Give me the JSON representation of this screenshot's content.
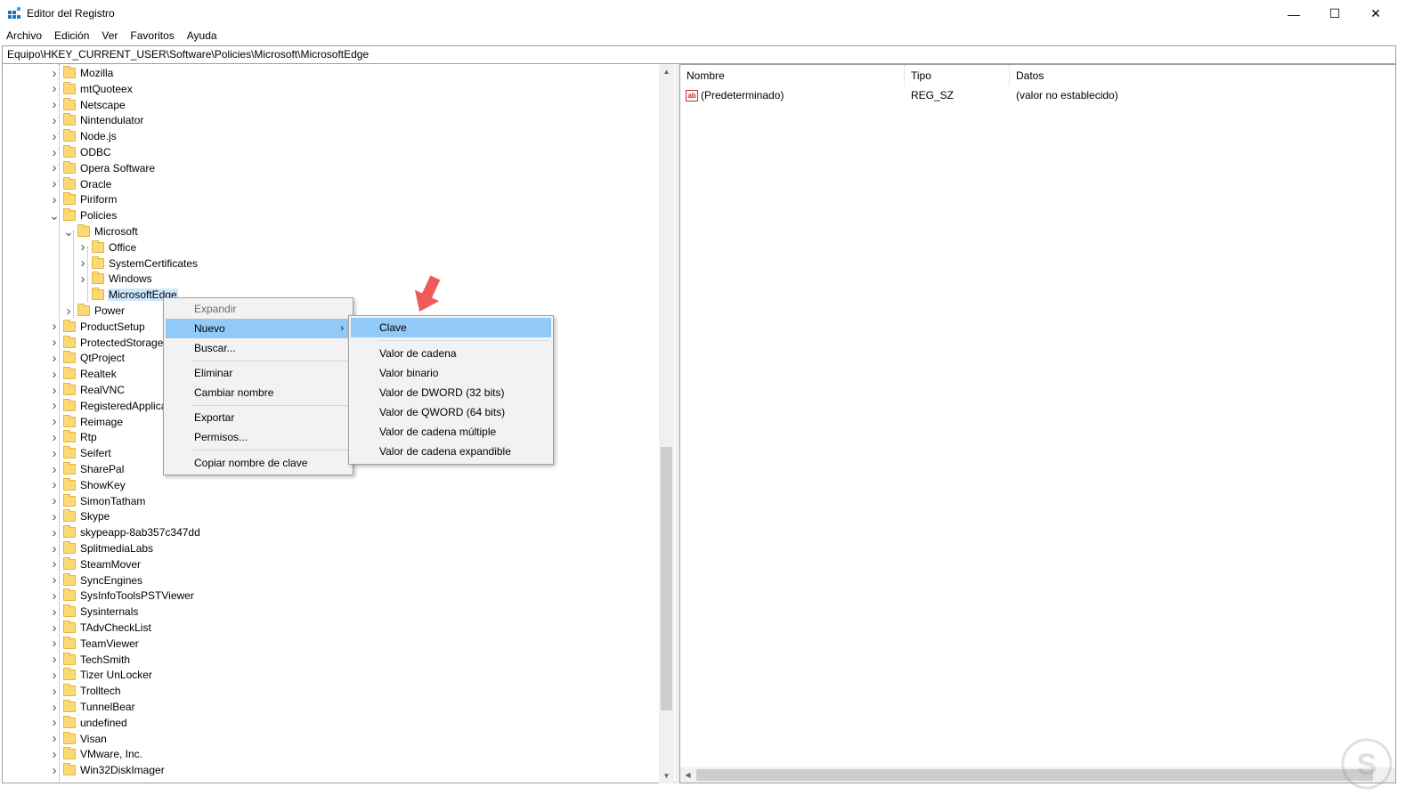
{
  "window": {
    "title": "Editor del Registro",
    "controls": {
      "minimize": "—",
      "maximize": "☐",
      "close": "✕"
    }
  },
  "menu": [
    "Archivo",
    "Edición",
    "Ver",
    "Favoritos",
    "Ayuda"
  ],
  "address": "Equipo\\HKEY_CURRENT_USER\\Software\\Policies\\Microsoft\\MicrosoftEdge",
  "tree": {
    "items": [
      {
        "label": "Mozilla",
        "level": 0,
        "expander": ">"
      },
      {
        "label": "mtQuoteex",
        "level": 0,
        "expander": ">"
      },
      {
        "label": "Netscape",
        "level": 0,
        "expander": ">"
      },
      {
        "label": "Nintendulator",
        "level": 0,
        "expander": ">"
      },
      {
        "label": "Node.js",
        "level": 0,
        "expander": ">"
      },
      {
        "label": "ODBC",
        "level": 0,
        "expander": ">"
      },
      {
        "label": "Opera Software",
        "level": 0,
        "expander": ">"
      },
      {
        "label": "Oracle",
        "level": 0,
        "expander": ">"
      },
      {
        "label": "Piriform",
        "level": 0,
        "expander": ">"
      },
      {
        "label": "Policies",
        "level": 0,
        "expander": "v"
      },
      {
        "label": "Microsoft",
        "level": 1,
        "expander": "v"
      },
      {
        "label": "Office",
        "level": 2,
        "expander": ">"
      },
      {
        "label": "SystemCertificates",
        "level": 2,
        "expander": ">"
      },
      {
        "label": "Windows",
        "level": 2,
        "expander": ">"
      },
      {
        "label": "MicrosoftEdge",
        "level": 2,
        "expander": "",
        "selected": true
      },
      {
        "label": "Power",
        "level": 1,
        "expander": ">"
      },
      {
        "label": "ProductSetup",
        "level": 0,
        "expander": ">"
      },
      {
        "label": "ProtectedStorage",
        "level": 0,
        "expander": ">"
      },
      {
        "label": "QtProject",
        "level": 0,
        "expander": ">"
      },
      {
        "label": "Realtek",
        "level": 0,
        "expander": ">"
      },
      {
        "label": "RealVNC",
        "level": 0,
        "expander": ">"
      },
      {
        "label": "RegisteredApplica",
        "level": 0,
        "expander": ">"
      },
      {
        "label": "Reimage",
        "level": 0,
        "expander": ">"
      },
      {
        "label": "Rtp",
        "level": 0,
        "expander": ">"
      },
      {
        "label": "Seifert",
        "level": 0,
        "expander": ">"
      },
      {
        "label": "SharePal",
        "level": 0,
        "expander": ">"
      },
      {
        "label": "ShowKey",
        "level": 0,
        "expander": ">"
      },
      {
        "label": "SimonTatham",
        "level": 0,
        "expander": ">"
      },
      {
        "label": "Skype",
        "level": 0,
        "expander": ">"
      },
      {
        "label": "skypeapp-8ab357c347dd",
        "level": 0,
        "expander": ">"
      },
      {
        "label": "SplitmediaLabs",
        "level": 0,
        "expander": ">"
      },
      {
        "label": "SteamMover",
        "level": 0,
        "expander": ">"
      },
      {
        "label": "SyncEngines",
        "level": 0,
        "expander": ">"
      },
      {
        "label": "SysInfoToolsPSTViewer",
        "level": 0,
        "expander": ">"
      },
      {
        "label": "Sysinternals",
        "level": 0,
        "expander": ">"
      },
      {
        "label": "TAdvCheckList",
        "level": 0,
        "expander": ">"
      },
      {
        "label": "TeamViewer",
        "level": 0,
        "expander": ">"
      },
      {
        "label": "TechSmith",
        "level": 0,
        "expander": ">"
      },
      {
        "label": "Tizer UnLocker",
        "level": 0,
        "expander": ">"
      },
      {
        "label": "Trolltech",
        "level": 0,
        "expander": ">"
      },
      {
        "label": "TunnelBear",
        "level": 0,
        "expander": ">"
      },
      {
        "label": "undefined",
        "level": 0,
        "expander": ">"
      },
      {
        "label": "Visan",
        "level": 0,
        "expander": ">"
      },
      {
        "label": "VMware, Inc.",
        "level": 0,
        "expander": ">"
      },
      {
        "label": "Win32DiskImager",
        "level": 0,
        "expander": ">"
      }
    ]
  },
  "list": {
    "columns": [
      "Nombre",
      "Tipo",
      "Datos"
    ],
    "rows": [
      {
        "name": "(Predeterminado)",
        "type": "REG_SZ",
        "data": "(valor no establecido)",
        "icon": "ab-string-icon"
      }
    ]
  },
  "context_menu": {
    "items": [
      {
        "label": "Expandir",
        "disabled": true
      },
      {
        "label": "Nuevo",
        "submenu": true,
        "hover": true
      },
      {
        "label": "Buscar..."
      },
      {
        "separator": true
      },
      {
        "label": "Eliminar"
      },
      {
        "label": "Cambiar nombre"
      },
      {
        "separator": true
      },
      {
        "label": "Exportar"
      },
      {
        "label": "Permisos..."
      },
      {
        "separator": true
      },
      {
        "label": "Copiar nombre de clave"
      }
    ]
  },
  "submenu": {
    "items": [
      {
        "label": "Clave",
        "hover": true
      },
      {
        "separator": true
      },
      {
        "label": "Valor de cadena"
      },
      {
        "label": "Valor binario"
      },
      {
        "label": "Valor de DWORD (32 bits)"
      },
      {
        "label": "Valor de QWORD (64 bits)"
      },
      {
        "label": "Valor de cadena múltiple"
      },
      {
        "label": "Valor de cadena expandible"
      }
    ]
  },
  "colors": {
    "menu_hover": "#91c9f7",
    "selected_tree": "#cce8ff",
    "annotation_arrow": "#f05a5a",
    "folder": "#fcd975"
  }
}
